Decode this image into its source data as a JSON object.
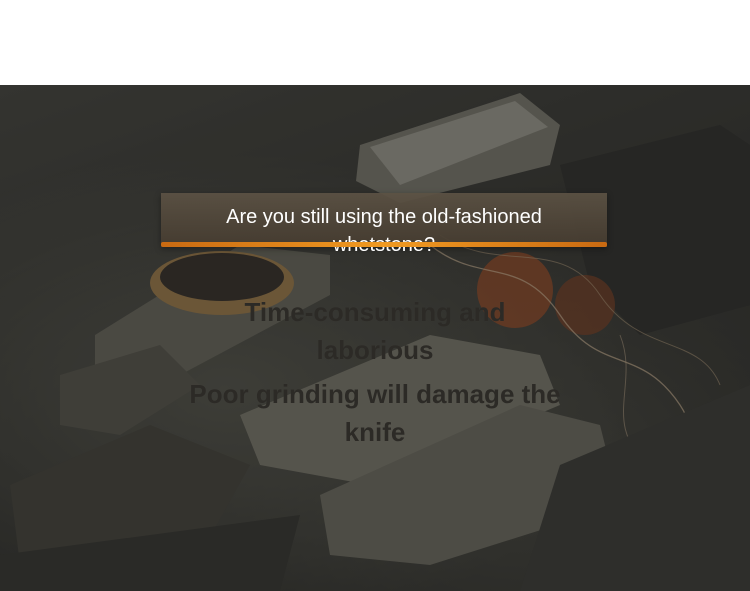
{
  "banner": {
    "question_line1": "Are you still using the old-fashioned",
    "question_line2": "whetstone?"
  },
  "points": {
    "point1_line1": "Time-consuming and",
    "point1_line2": "laborious",
    "point2_line1": "Poor grinding will damage the",
    "point2_line2": "knife"
  },
  "colors": {
    "accent": "#f09a22",
    "banner_bg": "#5c5244",
    "overlay_text": "#2c2a26"
  }
}
